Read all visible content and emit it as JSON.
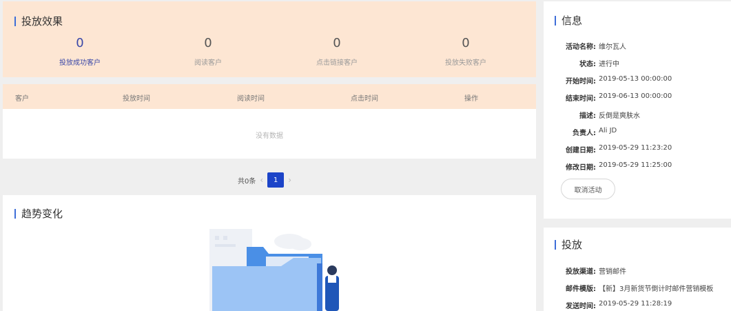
{
  "effect": {
    "title": "投放效果",
    "stats": [
      {
        "value": "0",
        "label": "投放成功客户"
      },
      {
        "value": "0",
        "label": "阅读客户"
      },
      {
        "value": "0",
        "label": "点击链接客户"
      },
      {
        "value": "0",
        "label": "投放失败客户"
      }
    ]
  },
  "table": {
    "columns": [
      "客户",
      "投放时间",
      "阅读时间",
      "点击时间",
      "操作"
    ],
    "empty_text": "没有数据"
  },
  "pagination": {
    "total": "共0条",
    "current_page": "1",
    "prev_icon": "chevron-left-icon",
    "next_icon": "chevron-right-icon"
  },
  "trend": {
    "title": "趋势变化"
  },
  "info": {
    "title": "信息",
    "rows": [
      {
        "key": "活动名称:",
        "value": "维尔瓦人"
      },
      {
        "key": "状态:",
        "value": "进行中"
      },
      {
        "key": "开始时间:",
        "value": "2019-05-13 00:00:00"
      },
      {
        "key": "结束时间:",
        "value": "2019-06-13 00:00:00"
      },
      {
        "key": "描述:",
        "value": "反倒是爽肤水"
      },
      {
        "key": "负责人:",
        "value": "Ali JD"
      },
      {
        "key": "创建日期:",
        "value": "2019-05-29 11:23:20"
      },
      {
        "key": "修改日期:",
        "value": "2019-05-29 11:25:00"
      }
    ],
    "cancel_label": "取消活动"
  },
  "delivery": {
    "title": "投放",
    "rows": [
      {
        "key": "投放渠道:",
        "value": "营销邮件"
      },
      {
        "key": "邮件模版:",
        "value": "【新】3月新货节倒计时邮件营销模板"
      },
      {
        "key": "发送时间:",
        "value": "2019-05-29 11:28:19"
      }
    ]
  },
  "colors": {
    "accent": "#3d6dd8",
    "header_bg": "#fde6d3",
    "page_active": "#1c44c8",
    "primary_stat": "#3a48a8"
  }
}
